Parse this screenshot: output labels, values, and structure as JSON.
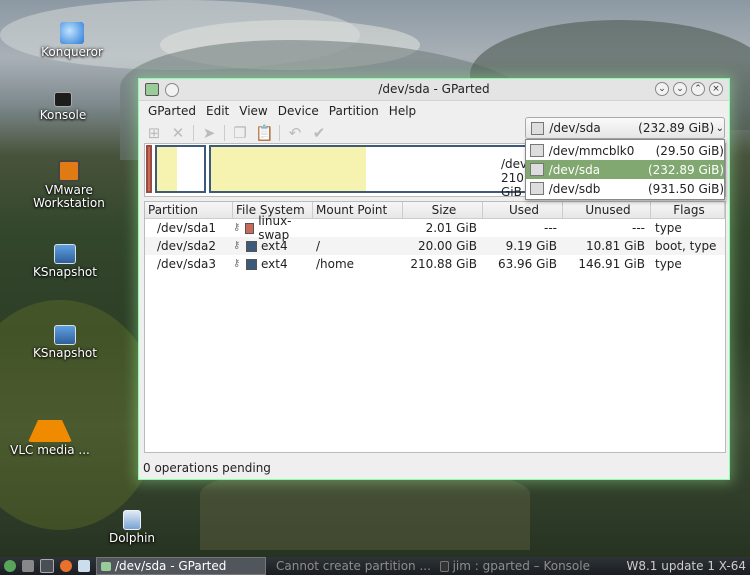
{
  "desktop": {
    "icons": [
      {
        "label": "Konqueror"
      },
      {
        "label": "Konsole"
      },
      {
        "label": "VMware Workstation"
      },
      {
        "label": "KSnapshot"
      },
      {
        "label": "KSnapshot"
      },
      {
        "label": "VLC media ..."
      },
      {
        "label": "Dolphin"
      }
    ]
  },
  "window": {
    "title": "/dev/sda - GParted",
    "menu": [
      "GParted",
      "Edit",
      "View",
      "Device",
      "Partition",
      "Help"
    ],
    "device_selector": {
      "name": "/dev/sda",
      "size": "(232.89 GiB)"
    },
    "device_list": [
      {
        "name": "/dev/mmcblk0",
        "size": "(29.50 GiB)",
        "selected": false
      },
      {
        "name": "/dev/sda",
        "size": "(232.89 GiB)",
        "selected": true
      },
      {
        "name": "/dev/sdb",
        "size": "(931.50 GiB)",
        "selected": false
      }
    ],
    "diskmap_label": {
      "name": "/dev/sda3",
      "size": "210.88 GiB"
    },
    "columns": [
      "Partition",
      "File System",
      "Mount Point",
      "Size",
      "Used",
      "Unused",
      "Flags"
    ],
    "partitions": [
      {
        "partition": "/dev/sda1",
        "fs": "linux-swap",
        "fs_color": "#c96a5a",
        "mount": "",
        "size": "2.01 GiB",
        "used": "---",
        "unused": "---",
        "flags": "type"
      },
      {
        "partition": "/dev/sda2",
        "fs": "ext4",
        "fs_color": "#3d5a7a",
        "mount": "/",
        "size": "20.00 GiB",
        "used": "9.19 GiB",
        "unused": "10.81 GiB",
        "flags": "boot, type"
      },
      {
        "partition": "/dev/sda3",
        "fs": "ext4",
        "fs_color": "#3d5a7a",
        "mount": "/home",
        "size": "210.88 GiB",
        "used": "63.96 GiB",
        "unused": "146.91 GiB",
        "flags": "type"
      }
    ],
    "status": "0 operations pending"
  },
  "taskbar": {
    "tasks": [
      {
        "label": "/dev/sda - GParted",
        "active": true
      },
      {
        "label": "Cannot create partition ...",
        "active": false
      },
      {
        "label": "jim : gparted – Konsole",
        "active": false
      }
    ],
    "tray_text": "W8.1 update 1 X-64"
  }
}
